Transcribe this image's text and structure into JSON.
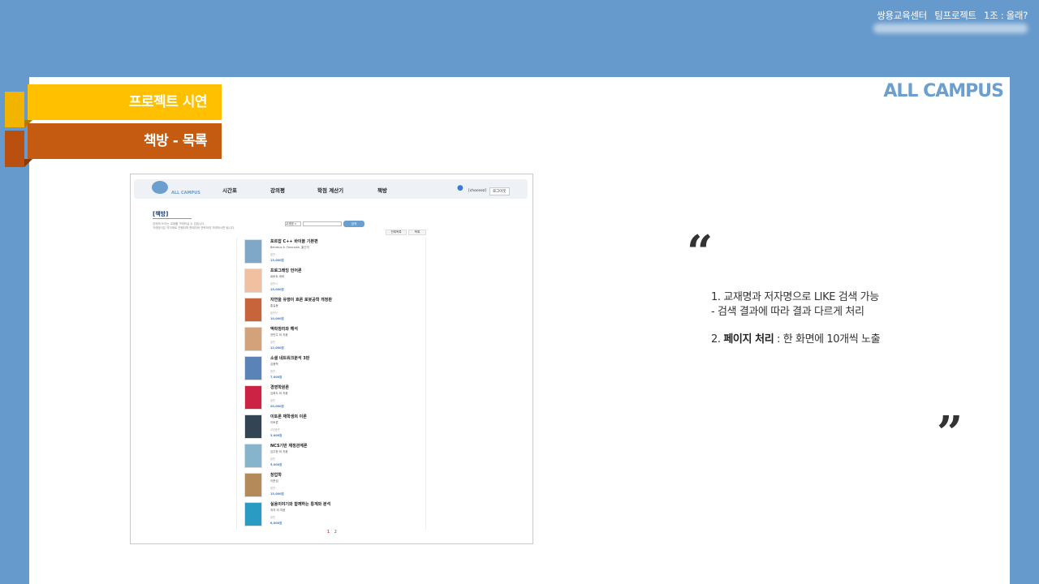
{
  "header": {
    "org": "쌍용교육센터",
    "project": "팀프로젝트",
    "team": "1조 : 올래?"
  },
  "brand": "ALL CAMPUS",
  "ribbons": [
    "프로젝트 시연",
    "책방 - 목록"
  ],
  "screenshot": {
    "nav": {
      "logo_text": "ALL CAMPUS",
      "items": [
        "시간표",
        "강의평",
        "학점 계산기",
        "책방"
      ],
      "user_id": "[choceez]",
      "logout": "로그아웃"
    },
    "page_title": "[책방]",
    "notes": [
      "강의에 쓰이는 교재를 구매하실 수 있습니다.",
      "거래방식은 직거래로 진행되며 판매자와 연락하여 거래하시면 됩니다."
    ],
    "search_select": "교재명 ∨",
    "search_button": "검색",
    "view_buttons": [
      "전체목록",
      "목록"
    ],
    "books": [
      {
        "title": "포르잡 C++ 바이블 기본편",
        "author": "Behrouz A. Forouzan, 옮긴이",
        "pub": "출판",
        "price": "13,000원",
        "cover": "#7fa7c7"
      },
      {
        "title": "프로그래밍 언어론",
        "author": "로버트 세바",
        "pub": "출판사",
        "price": "15,000원",
        "cover": "#f0c0a0"
      },
      {
        "title": "자연을 유행이 흐른 로봇공학 개정판",
        "author": "홍길동",
        "pub": "출판사",
        "price": "10,000원",
        "cover": "#c8643c"
      },
      {
        "title": "맥락정리와 해석",
        "author": "권민주 외 지음",
        "pub": "출판",
        "price": "12,000원",
        "cover": "#d4a27a"
      },
      {
        "title": "소셜 네트워크분석 3판",
        "author": "김용학",
        "pub": "출판",
        "price": "7,000원",
        "cover": "#5a84b8"
      },
      {
        "title": "경영학원론",
        "author": "김희도 외 지음",
        "pub": "출판",
        "price": "20,000원",
        "cover": "#cc2244"
      },
      {
        "title": "이토론 재학생의 이론",
        "author": "이토론",
        "pub": "교양출판",
        "price": "3,000원",
        "cover": "#334455"
      },
      {
        "title": "NCS기반 재정관계론",
        "author": "김주한 외 지음",
        "pub": "출판",
        "price": "5,000원",
        "cover": "#86b4cc"
      },
      {
        "title": "창업학",
        "author": "이준섭",
        "pub": "출판",
        "price": "15,000원",
        "cover": "#b58a5a"
      },
      {
        "title": "실용이야기와 함께하는 통계와 분석",
        "author": "저자 외 지음",
        "pub": "출판",
        "price": "8,000원",
        "cover": "#2a9cc4"
      }
    ],
    "pages": [
      "1",
      "2"
    ]
  },
  "description": {
    "line1": "1. 교재명과 저자명으로 LIKE 검색 가능",
    "line2": "- 검색 결과에 따라 결과 다르게 처리",
    "line3_prefix": "2. ",
    "line3_bold": "페이지 처리",
    "line3_suffix": " : 한 화면에 10개씩 노출"
  },
  "quotes": {
    "open": "“",
    "close": "”"
  }
}
